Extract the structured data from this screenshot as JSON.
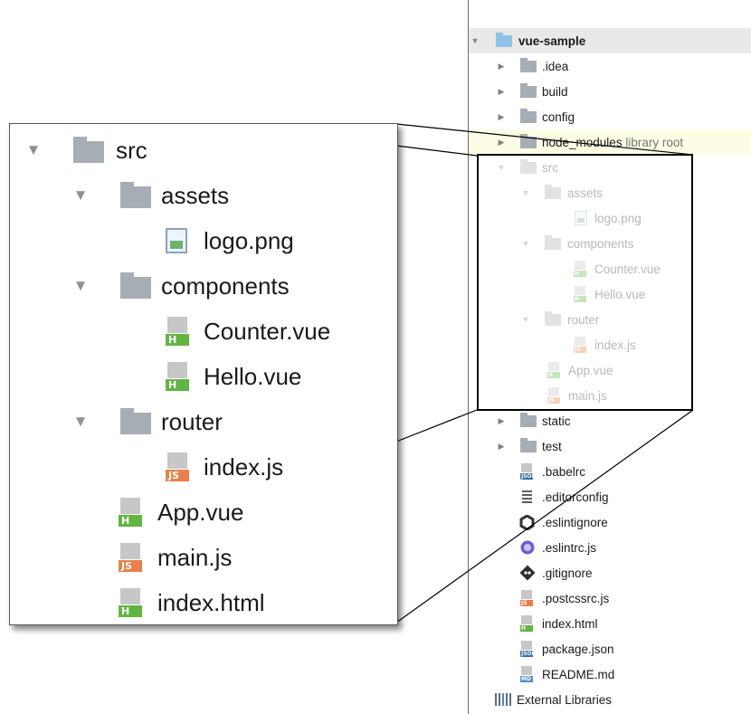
{
  "project_tree": {
    "root": {
      "label": "vue-sample"
    },
    "items": [
      {
        "label": ".idea",
        "type": "folder"
      },
      {
        "label": "build",
        "type": "folder"
      },
      {
        "label": "config",
        "type": "folder"
      },
      {
        "label": "node_modules",
        "suffix": "library root",
        "type": "folder"
      },
      {
        "label": "src",
        "type": "folder"
      },
      {
        "label": "assets",
        "type": "folder"
      },
      {
        "label": "logo.png",
        "type": "image"
      },
      {
        "label": "components",
        "type": "folder"
      },
      {
        "label": "Counter.vue",
        "type": "vue"
      },
      {
        "label": "Hello.vue",
        "type": "vue"
      },
      {
        "label": "router",
        "type": "folder"
      },
      {
        "label": "index.js",
        "type": "js"
      },
      {
        "label": "App.vue",
        "type": "vue"
      },
      {
        "label": "main.js",
        "type": "js"
      },
      {
        "label": "static",
        "type": "folder"
      },
      {
        "label": "test",
        "type": "folder"
      },
      {
        "label": ".babelrc",
        "type": "json"
      },
      {
        "label": ".editorconfig",
        "type": "text"
      },
      {
        "label": ".eslintignore",
        "type": "eslintignore"
      },
      {
        "label": ".eslintrc.js",
        "type": "eslint"
      },
      {
        "label": ".gitignore",
        "type": "git"
      },
      {
        "label": ".postcssrc.js",
        "type": "js"
      },
      {
        "label": "index.html",
        "type": "html"
      },
      {
        "label": "package.json",
        "type": "json"
      },
      {
        "label": "README.md",
        "type": "md"
      },
      {
        "label": "External Libraries",
        "type": "libraries"
      }
    ]
  },
  "zoom_callout": {
    "items": [
      {
        "label": "src"
      },
      {
        "label": "assets"
      },
      {
        "label": "logo.png"
      },
      {
        "label": "components"
      },
      {
        "label": "Counter.vue"
      },
      {
        "label": "Hello.vue"
      },
      {
        "label": "router"
      },
      {
        "label": "index.js"
      },
      {
        "label": "App.vue"
      },
      {
        "label": "main.js"
      },
      {
        "label": "index.html"
      }
    ]
  },
  "file_tags": {
    "html": "H",
    "js": "JS",
    "json": "JSON",
    "md": "MD"
  },
  "colors": {
    "selection": "#e9e9e9",
    "library_root_bg": "#fdfde6",
    "folder": "#a7adb4",
    "vue_tag": "#62b543",
    "js_tag": "#e8804a"
  }
}
